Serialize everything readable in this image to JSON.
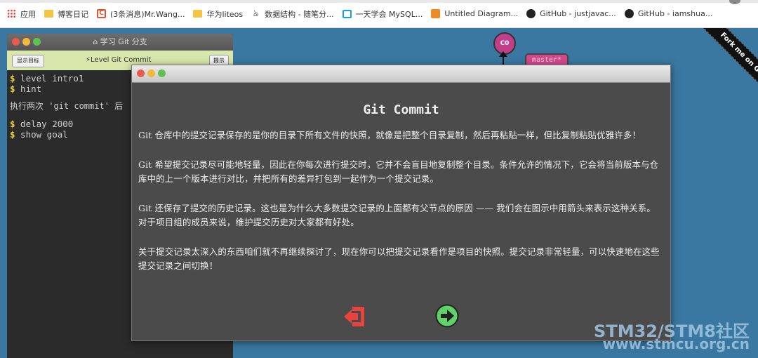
{
  "bookmarks": [
    {
      "label": "应用",
      "icon": "apps-grid-icon"
    },
    {
      "label": "博客日记",
      "icon": "folder-icon"
    },
    {
      "label": "(3条消息)Mr.Wang...",
      "icon": "csdn-icon"
    },
    {
      "label": "华为liteos",
      "icon": "folder-icon"
    },
    {
      "label": "数据结构 - 随笔分...",
      "icon": "cnblogs-icon"
    },
    {
      "label": "一天学会 MySQL...",
      "icon": "bilibili-icon"
    },
    {
      "label": "Untitled Diagram...",
      "icon": "diagram-icon"
    },
    {
      "label": "GitHub - justjavac...",
      "icon": "github-icon"
    },
    {
      "label": "GitHub - iamshua...",
      "icon": "github-icon"
    }
  ],
  "terminal": {
    "title": "学习 Git 分支",
    "goal_button": "显示目标",
    "level_label": "Level Git Commit",
    "right_button": "提示",
    "lines": [
      {
        "prompt": "$",
        "text": " level intro1"
      },
      {
        "prompt": "$",
        "text": " hint"
      }
    ],
    "message": "执行两次 'git commit' 后",
    "lines2": [
      {
        "prompt": "$",
        "text": " delay 2000"
      },
      {
        "prompt": "$",
        "text": " show goal"
      }
    ]
  },
  "graph": {
    "commit_label": "C0",
    "branch_label": "master*",
    "commit_color": "#c23e8a"
  },
  "ribbon": {
    "label": "Fork me on GitHub"
  },
  "modal": {
    "title": "Git Commit",
    "paragraphs": [
      "Git 仓库中的提交记录保存的是你的目录下所有文件的快照，就像是把整个目录复制，然后再粘贴一样，但比复制粘贴优雅许多！",
      "Git 希望提交记录尽可能地轻量，因此在你每次进行提交时，它并不会盲目地复制整个目录。条件允许的情况下，它会将当前版本与仓库中的上一个版本进行对比，并把所有的差异打包到一起作为一个提交记录。",
      "Git 还保存了提交的历史记录。这也是为什么大多数提交记录的上面都有父节点的原因 —— 我们会在图示中用箭头来表示这种关系。对于项目组的成员来说，维护提交历史对大家都有好处。",
      "关于提交记录太深入的东西咱们就不再继续探讨了，现在你可以把提交记录看作是项目的快照。提交记录非常轻量，可以快速地在这些提交记录之间切换！"
    ],
    "back_color": "#e8433c",
    "next_color": "#5fd36a"
  },
  "watermark": {
    "line1": "STM32/STM8社区",
    "line2": "www.stmcu.org.cn"
  }
}
